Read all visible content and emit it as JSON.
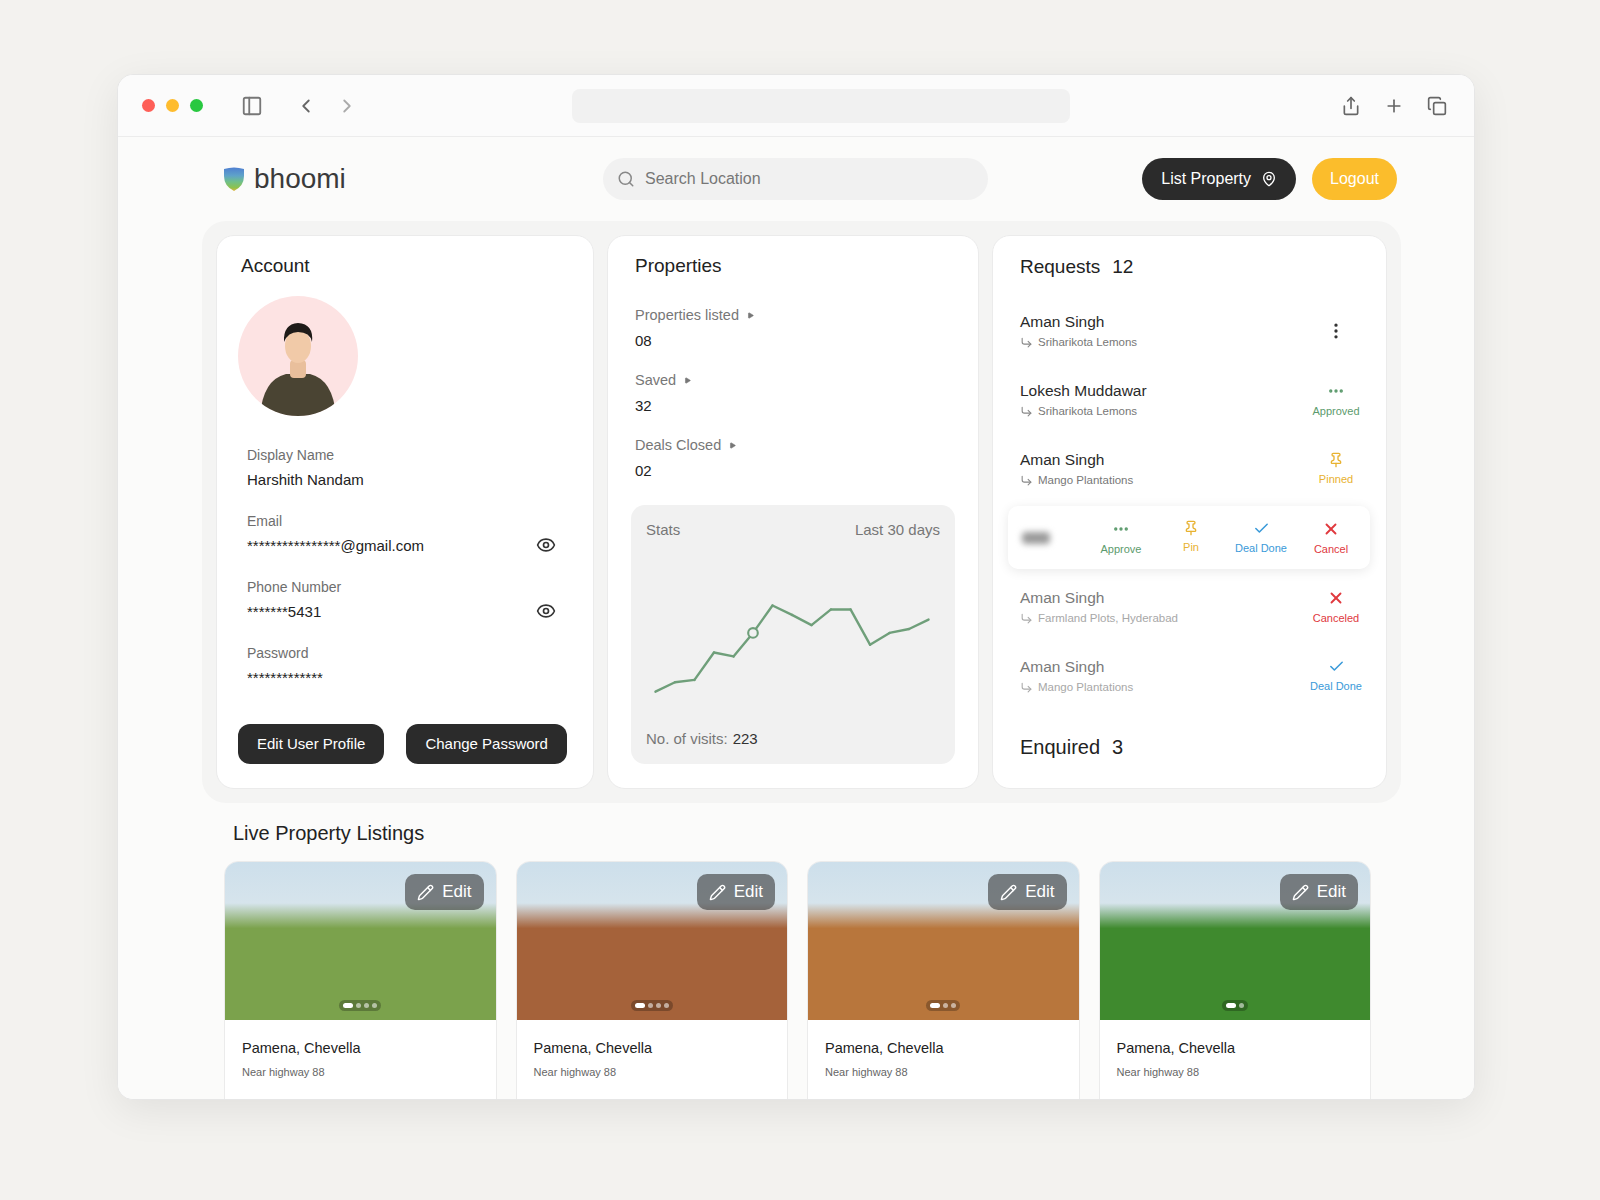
{
  "header": {
    "logo": "bhoomi",
    "search": {
      "placeholder": "Search Location"
    },
    "buttons": [
      {
        "label": "List Property",
        "kind": "primary"
      },
      {
        "label": "Logout",
        "kind": "accent"
      }
    ]
  },
  "account": {
    "title": "Account",
    "fields": [
      {
        "label": "Display Name",
        "value": "Harshith Nandam",
        "revealable": false
      },
      {
        "label": "Email",
        "value": "****************@gmail.com",
        "revealable": true
      },
      {
        "label": "Phone Number",
        "value": "*******5431",
        "revealable": true
      },
      {
        "label": "Password",
        "value": "*************",
        "revealable": false
      }
    ],
    "buttons": [
      "Edit User Profile",
      "Change Password"
    ]
  },
  "properties": {
    "title": "Properties",
    "counts": [
      {
        "label": "Properties listed",
        "value": "08"
      },
      {
        "label": "Saved",
        "value": "32"
      },
      {
        "label": "Deals Closed",
        "value": "02"
      }
    ],
    "stats": {
      "title": "Stats",
      "range": "Last 30 days",
      "series": [
        20,
        32,
        35,
        70,
        65,
        95,
        130,
        118,
        105,
        125,
        125,
        80,
        95,
        100,
        112
      ],
      "marker_index": 5,
      "visits_label": "No. of visits:",
      "visits": "223"
    }
  },
  "requests": {
    "title": "Requests",
    "count": "12",
    "items": [
      {
        "kind": "menu",
        "name": "Aman Singh",
        "property": "Sriharikota Lemons",
        "dimmed": false
      },
      {
        "kind": "approved",
        "name": "Lokesh Muddawar",
        "property": "Sriharikota Lemons",
        "status": "Approved",
        "color": "#5c9b6d",
        "dimmed": false
      },
      {
        "kind": "pinned",
        "name": "Aman Singh",
        "property": "Mango Plantations",
        "status": "Pinned",
        "color": "#e8b230",
        "dimmed": false
      },
      {
        "kind": "actions",
        "actions": [
          {
            "kind": "approve",
            "label": "Approve",
            "color": "#5c9b6d"
          },
          {
            "kind": "pin",
            "label": "Pin",
            "color": "#e8b230"
          },
          {
            "kind": "deal_done",
            "label": "Deal Done",
            "color": "#3a9ad9"
          },
          {
            "kind": "cancel",
            "label": "Cancel",
            "color": "#e0393e"
          }
        ]
      },
      {
        "kind": "canceled",
        "name": "Aman Singh",
        "property": "Farmland Plots, Hyderabad",
        "status": "Canceled",
        "color": "#e0393e",
        "dimmed": true
      },
      {
        "kind": "deal_done",
        "name": "Aman Singh",
        "property": "Mango Plantations",
        "status": "Deal Done",
        "color": "#3a9ad9",
        "dimmed": true
      }
    ],
    "enquired": {
      "title": "Enquired",
      "count": "3"
    }
  },
  "listings": {
    "title": "Live Property Listings",
    "items": [
      {
        "place": "Pamena, Chevella",
        "note": "Near highway 88",
        "edit": "Edit",
        "photos": 4,
        "current": 0,
        "color": "#7ba24c"
      },
      {
        "place": "Pamena, Chevella",
        "note": "Near highway 88",
        "edit": "Edit",
        "photos": 4,
        "current": 0,
        "color": "#a5623a"
      },
      {
        "place": "Pamena, Chevella",
        "note": "Near highway 88",
        "edit": "Edit",
        "photos": 3,
        "current": 0,
        "color": "#b8763c"
      },
      {
        "place": "Pamena, Chevella",
        "note": "Near highway 88",
        "edit": "Edit",
        "photos": 2,
        "current": 0,
        "color": "#3f8a2e"
      }
    ]
  }
}
